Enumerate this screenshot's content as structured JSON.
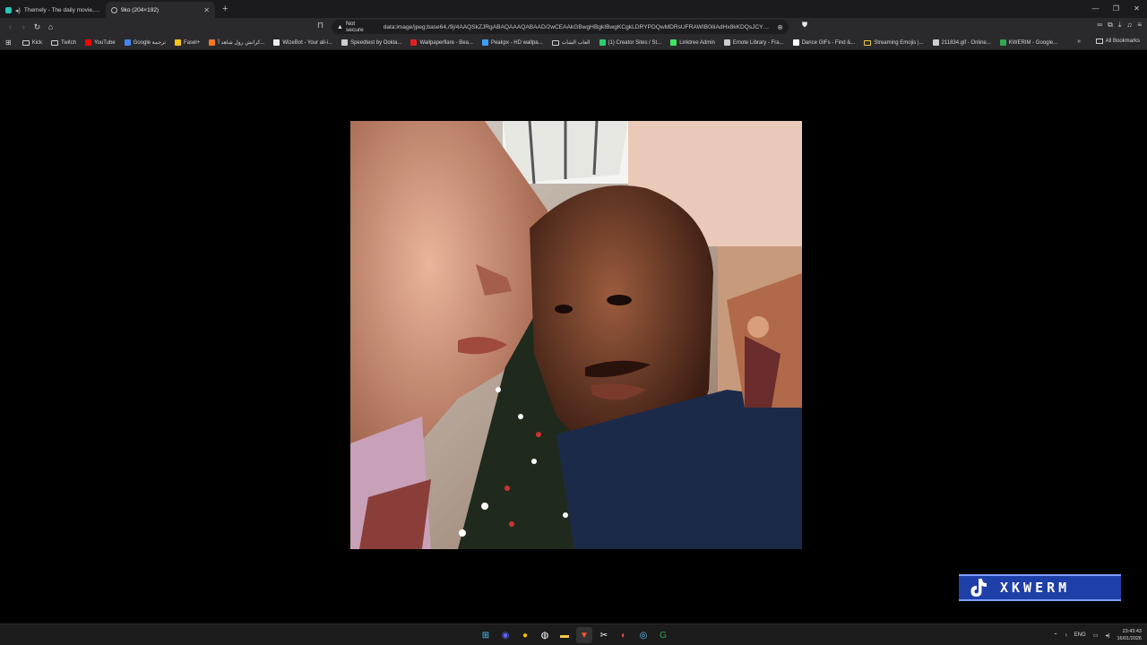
{
  "browser": {
    "tabs": [
      {
        "title": "Themely - The daily movie, game",
        "active": false
      },
      {
        "title": "9ko (204×192)",
        "active": true
      }
    ],
    "new_tab_symbol": "+",
    "address": {
      "security_label": "Not secure",
      "url": "data:image/jpeg;base64,/9j/4AAQSkZJRgABAQAAAQABAAD/2wCEAAkGBwgHBgkIBwgKCgkLDRYPDQwMDRsUFRAWIB0iIiAdHx8kKDQsJCYxJ..."
    },
    "bookmarks": [
      {
        "label": "Kick",
        "icon": "folder-icon",
        "color": "#cfcfcf"
      },
      {
        "label": "Twitch",
        "icon": "folder-icon",
        "color": "#cfcfcf"
      },
      {
        "label": "YouTube",
        "icon": "youtube-icon",
        "color": "#ff0000"
      },
      {
        "label": "Google ترجمة",
        "icon": "google-translate-icon",
        "color": "#4285f4"
      },
      {
        "label": "Fasel+",
        "icon": "heart-icon",
        "color": "#f5c518"
      },
      {
        "label": "كرانش رول شاهد أ...",
        "icon": "crunchyroll-icon",
        "color": "#f47521"
      },
      {
        "label": "WizeBot - Your all-i...",
        "icon": "wizebot-icon",
        "color": "#eeeeee"
      },
      {
        "label": "Speedtest by Ookla...",
        "icon": "speedtest-icon",
        "color": "#cccccc"
      },
      {
        "label": "Wallpaperflare - Bea...",
        "icon": "wallpaperflare-icon",
        "color": "#e02020"
      },
      {
        "label": "Peakpx - HD wallpa...",
        "icon": "peakpx-icon",
        "color": "#3aa0ff"
      },
      {
        "label": "العاب الشات",
        "icon": "folder-icon",
        "color": "#cfcfcf"
      },
      {
        "label": "(1) Creator Sites / St...",
        "icon": "creator-icon",
        "color": "#2ecc71"
      },
      {
        "label": "Linktree Admin",
        "icon": "linktree-icon",
        "color": "#43e660"
      },
      {
        "label": "Emote Library - Fra...",
        "icon": "emote-icon",
        "color": "#cccccc"
      },
      {
        "label": "Dance GIFs - Find &...",
        "icon": "page-icon",
        "color": "#ffffff"
      },
      {
        "label": "Streaming Emojis |...",
        "icon": "folder-icon",
        "color": "#f2c94c"
      },
      {
        "label": "211834.gif - Online...",
        "icon": "gif-icon",
        "color": "#cccccc"
      },
      {
        "label": "KWERIM - Google...",
        "icon": "drive-icon",
        "color": "#34a853"
      }
    ],
    "all_bookmarks_label": "All Bookmarks"
  },
  "watermark": {
    "text": "XKWERM",
    "icon": "tiktok-icon",
    "bg_color": "#1f3fa8"
  },
  "taskbar": {
    "apps": [
      {
        "name": "windows-start-icon",
        "glyph": "⊞",
        "color": "#4cc2ff"
      },
      {
        "name": "discord-icon",
        "glyph": "◉",
        "color": "#5865f2"
      },
      {
        "name": "chrome-icon",
        "glyph": "●",
        "color": "#fbbc05"
      },
      {
        "name": "obs-icon",
        "glyph": "◍",
        "color": "#ffffff"
      },
      {
        "name": "file-explorer-icon",
        "glyph": "▬",
        "color": "#f2c94c"
      },
      {
        "name": "brave-icon",
        "glyph": "▼",
        "color": "#fb542b"
      },
      {
        "name": "capcut-icon",
        "glyph": "✂",
        "color": "#ffffff"
      },
      {
        "name": "chat-app-icon",
        "glyph": "◐",
        "color": "#e74c3c"
      },
      {
        "name": "steam-icon",
        "glyph": "◎",
        "color": "#66c0f4"
      },
      {
        "name": "google-icon",
        "glyph": "G",
        "color": "#34a853"
      }
    ],
    "tray": {
      "language": "ENG",
      "time": "23:43:43",
      "date": "16/01/2026"
    }
  }
}
